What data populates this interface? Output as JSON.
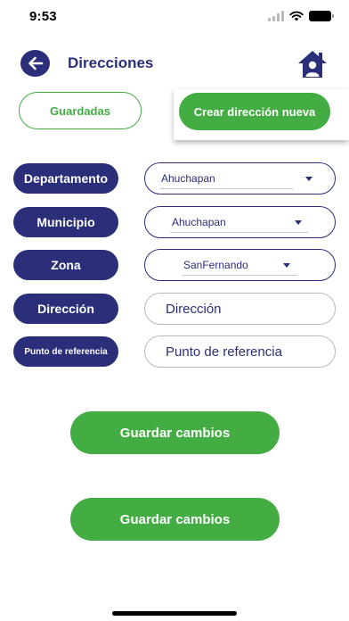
{
  "status_bar": {
    "time": "9:53",
    "icons": [
      "signal-icon",
      "wifi-icon",
      "battery-icon"
    ]
  },
  "header": {
    "title": "Direcciones",
    "back_icon": "arrow-left-icon",
    "home_icon": "home-user-icon"
  },
  "tabs": {
    "saved_label": "Guardadas",
    "new_label": "Crear dirección nueva"
  },
  "form": {
    "departamento": {
      "label": "Departamento",
      "value": "Ahuchapan"
    },
    "municipio": {
      "label": "Municipio",
      "value": "Ahuchapan"
    },
    "zona": {
      "label": "Zona",
      "value": "SanFernando"
    },
    "direccion": {
      "label": "Dirección",
      "placeholder": "Dirección"
    },
    "referencia": {
      "label": "Punto de referencia",
      "placeholder": "Punto de referencia"
    }
  },
  "buttons": {
    "save_1": "Guardar cambios",
    "save_2": "Guardar cambios"
  },
  "colors": {
    "navy": "#2b2f7a",
    "green": "#43ad43",
    "background": "#ffffff"
  }
}
